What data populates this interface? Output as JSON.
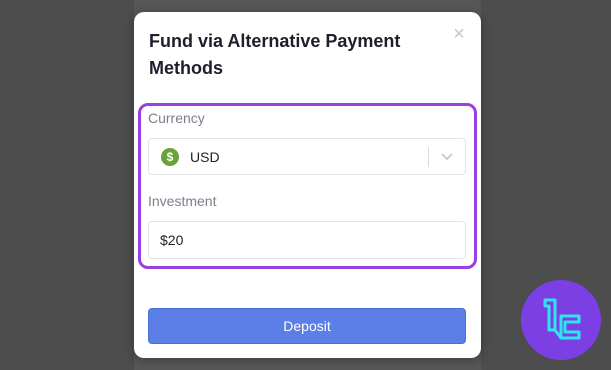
{
  "modal": {
    "title": "Fund via Alternative Payment Methods",
    "close_label": "×"
  },
  "currency": {
    "label": "Currency",
    "icon_symbol": "$",
    "selected_value": "USD"
  },
  "investment": {
    "label": "Investment",
    "value": "$20"
  },
  "actions": {
    "deposit_label": "Deposit"
  },
  "colors": {
    "highlight": "#9b3fe0",
    "primary_button": "#5b7fe6",
    "currency_icon": "#6aa23a",
    "logo_bg": "#7b3fe4"
  }
}
